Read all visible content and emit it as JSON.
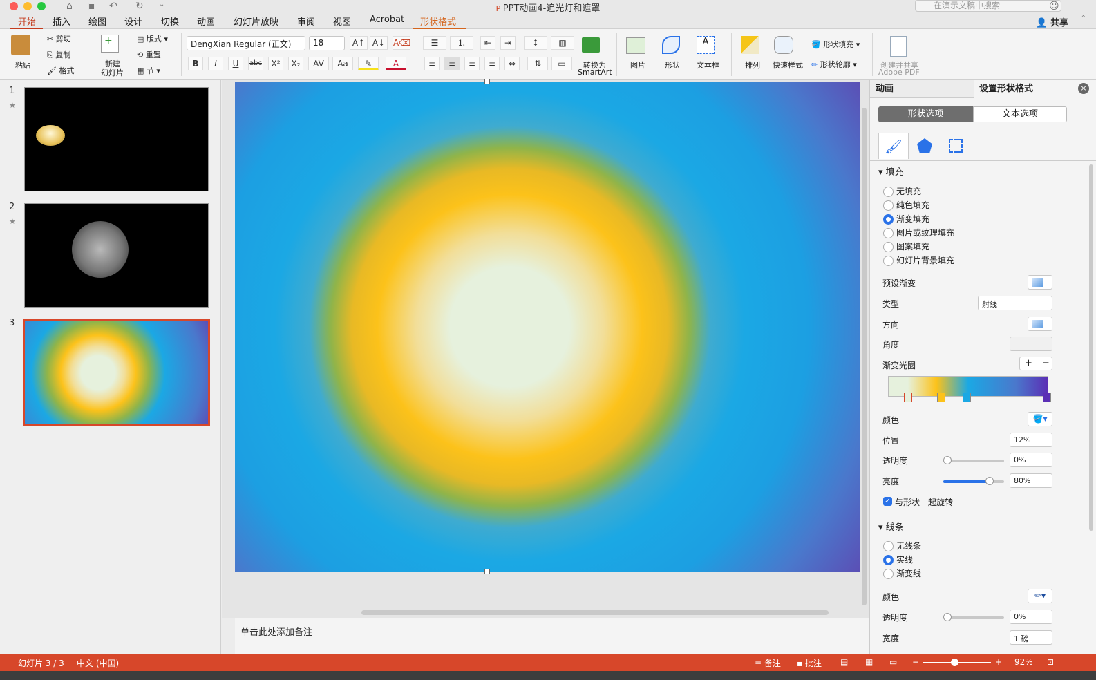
{
  "window": {
    "title": "PPT动画4-追光灯和遮罩",
    "search_placeholder": "在演示文稿中搜索",
    "share": "共享"
  },
  "tabs": [
    "开始",
    "插入",
    "绘图",
    "设计",
    "切换",
    "动画",
    "幻灯片放映",
    "审阅",
    "视图",
    "Acrobat",
    "形状格式"
  ],
  "ribbon": {
    "paste": "粘贴",
    "cut": "剪切",
    "copy": "复制",
    "format_painter": "格式",
    "new_slide_line1": "新建",
    "new_slide_line2": "幻灯片",
    "layout": "版式",
    "reset": "重置",
    "section": "节",
    "font_name": "DengXian Regular (正文)",
    "font_size": "18",
    "convert_smartart_line1": "转换为",
    "convert_smartart_line2": "SmartArt",
    "picture": "图片",
    "shape": "形状",
    "textbox": "文本框",
    "arrange": "排列",
    "quick_styles": "快速样式",
    "shape_fill": "形状填充",
    "shape_outline": "形状轮廓",
    "create_pdf_line1": "创建并共享",
    "create_pdf_line2": "Adobe PDF"
  },
  "slides": [
    {
      "number": "1",
      "star": "★"
    },
    {
      "number": "2",
      "star": "★"
    },
    {
      "number": "3",
      "star": ""
    }
  ],
  "notes_placeholder": "单击此处添加备注",
  "panel": {
    "tab_animation": "动画",
    "tab_format": "设置形状格式",
    "seg_shape": "形状选项",
    "seg_text": "文本选项",
    "fill_section": "填充",
    "fill_options": [
      "无填充",
      "纯色填充",
      "渐变填充",
      "图片或纹理填充",
      "图案填充",
      "幻灯片背景填充"
    ],
    "fill_selected": 2,
    "preset_gradient": "预设渐变",
    "type_label": "类型",
    "type_value": "射线",
    "direction": "方向",
    "angle": "角度",
    "gradient_stops": "渐变光圈",
    "color": "颜色",
    "position": "位置",
    "position_value": "12%",
    "transparency": "透明度",
    "transparency_value": "0%",
    "transparency_level": 0,
    "brightness": "亮度",
    "brightness_value": "80%",
    "brightness_level": 0.8,
    "rotate_with_shape": "与形状一起旋转",
    "line_section": "线条",
    "line_options": [
      "无线条",
      "实线",
      "渐变线"
    ],
    "line_selected": 1,
    "line_color": "颜色",
    "line_transparency": "透明度",
    "line_transparency_value": "0%",
    "line_width": "宽度",
    "line_width_value": "1 磅"
  },
  "status": {
    "slide_info": "幻灯片 3 / 3",
    "language": "中文 (中国)",
    "notes": "备注",
    "comments": "批注",
    "zoom": "92%"
  },
  "colors": {
    "accent": "#c43b1d",
    "status_bar": "#d7472a",
    "selected_radio": "#2a72e8"
  }
}
